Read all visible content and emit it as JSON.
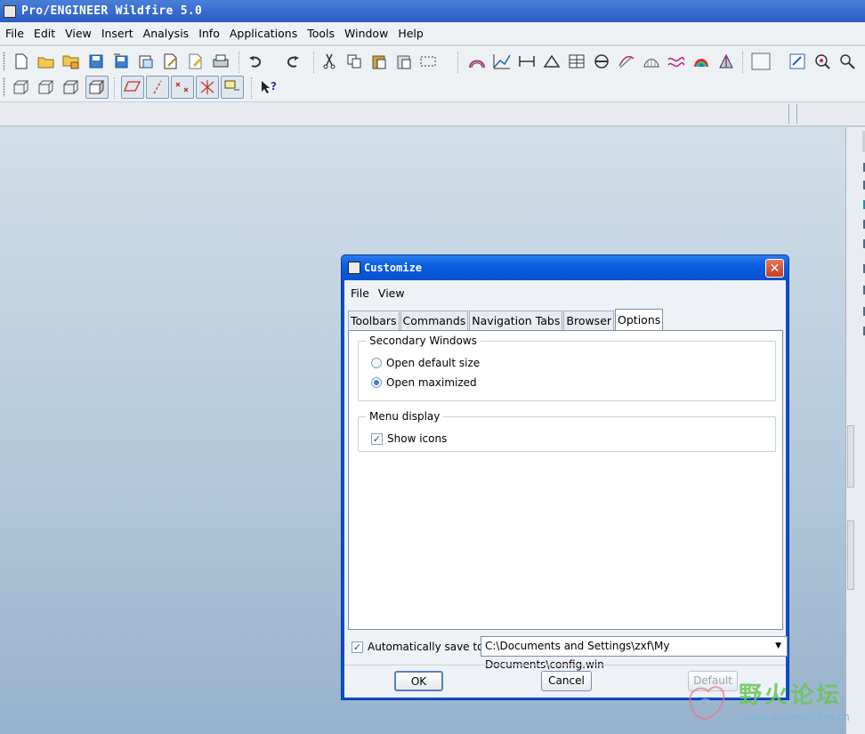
{
  "app": {
    "title": "Pro/ENGINEER Wildfire 5.0",
    "menu": [
      "File",
      "Edit",
      "View",
      "Insert",
      "Analysis",
      "Info",
      "Applications",
      "Tools",
      "Window",
      "Help"
    ]
  },
  "toolbar": {
    "row1_icons": [
      "new-icon",
      "open-icon",
      "open-folder-icon",
      "save-icon",
      "save-copy-icon",
      "backup-icon",
      "rename-icon",
      "erase-icon",
      "print-icon",
      "undo-icon",
      "redo-icon",
      "cut-icon",
      "copy-icon",
      "paste-icon",
      "paste-special-icon",
      "select-box-icon",
      "analysis-curvature-icon",
      "analysis-graph-icon",
      "measure-distance-icon",
      "measure-angle-icon",
      "measure-table-icon",
      "section-icon",
      "curve-analysis-icon",
      "surface-analysis-icon",
      "deviation-icon",
      "reflection-icon",
      "draft-icon",
      "color-swatch-icon",
      "repaint-icon",
      "spin-center-icon",
      "zoom-in-icon"
    ],
    "row2_icons": [
      "wireframe-icon",
      "hidden-line-icon",
      "no-hidden-icon",
      "shading-icon",
      "datum-planes-icon",
      "datum-axes-icon",
      "datum-points-icon",
      "coordinate-systems-icon",
      "annotations-icon",
      "whats-this-icon"
    ]
  },
  "dialog": {
    "title": "Customize",
    "menu": [
      "File",
      "View"
    ],
    "tabs": [
      "Toolbars",
      "Commands",
      "Navigation Tabs",
      "Browser",
      "Options"
    ],
    "active_tab": "Options",
    "secondary_windows": {
      "legend": "Secondary Windows",
      "opt_default": "Open default size",
      "opt_max": "Open maximized",
      "selected": "Open maximized"
    },
    "menu_display": {
      "legend": "Menu display",
      "show_icons": "Show icons",
      "show_icons_checked": true
    },
    "auto_save": {
      "label": "Automatically save to",
      "checked": true,
      "path": "C:\\Documents and Settings\\zxf\\My Documents\\config.win"
    },
    "buttons": {
      "ok": "OK",
      "cancel": "Cancel",
      "default": "Default"
    }
  },
  "watermark": {
    "text": "野火论坛",
    "url": "www.proewildfire.cn"
  }
}
